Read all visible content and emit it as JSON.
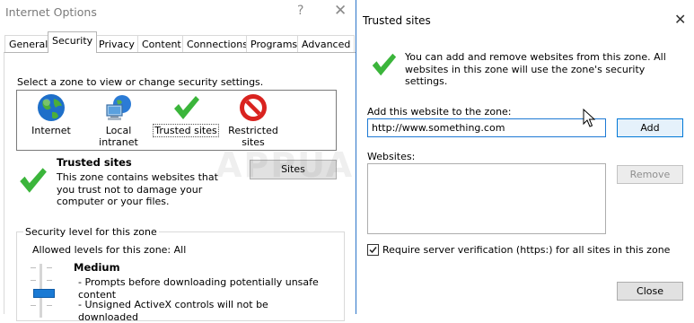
{
  "internet_options": {
    "title": "Internet Options",
    "help_glyph": "?",
    "close_glyph": "✕",
    "tabs": [
      {
        "label": "General",
        "active": false
      },
      {
        "label": "Security",
        "active": true
      },
      {
        "label": "Privacy",
        "active": false
      },
      {
        "label": "Content",
        "active": false
      },
      {
        "label": "Connections",
        "active": false
      },
      {
        "label": "Programs",
        "active": false
      },
      {
        "label": "Advanced",
        "active": false
      }
    ],
    "zone_prompt": "Select a zone to view or change security settings.",
    "zones": [
      {
        "label": "Internet",
        "icon": "globe-icon"
      },
      {
        "label": "Local intranet",
        "icon": "computer-network-icon"
      },
      {
        "label": "Trusted sites",
        "icon": "checkmark-icon"
      },
      {
        "label": "Restricted sites",
        "icon": "prohibited-icon"
      }
    ],
    "selected_zone": {
      "title": "Trusted sites",
      "description": "This zone contains websites that you trust not to damage your computer or your files.",
      "sites_button": "Sites"
    },
    "security_level": {
      "legend": "Security level for this zone",
      "allowed": "Allowed levels for this zone: All",
      "level_name": "Medium",
      "bullets": [
        "- Prompts before downloading potentially unsafe content",
        "- Unsigned ActiveX controls will not be downloaded"
      ]
    }
  },
  "watermark": "APPUALS",
  "trusted_sites_dialog": {
    "title": "Trusted sites",
    "close_glyph": "✕",
    "description": "You can add and remove websites from this zone. All websites in this zone will use the zone's security settings.",
    "add_label": "Add this website to the zone:",
    "url_value": "http://www.something.com",
    "add_button": "Add",
    "websites_label": "Websites:",
    "websites": [],
    "remove_button": "Remove",
    "require_https_label": "Require server verification (https:) for all sites in this zone",
    "require_https_checked": true,
    "close_button": "Close"
  },
  "colors": {
    "check_green": "#3bb53b",
    "accent_blue": "#0078d7",
    "prohibit_red": "#d9231f"
  }
}
